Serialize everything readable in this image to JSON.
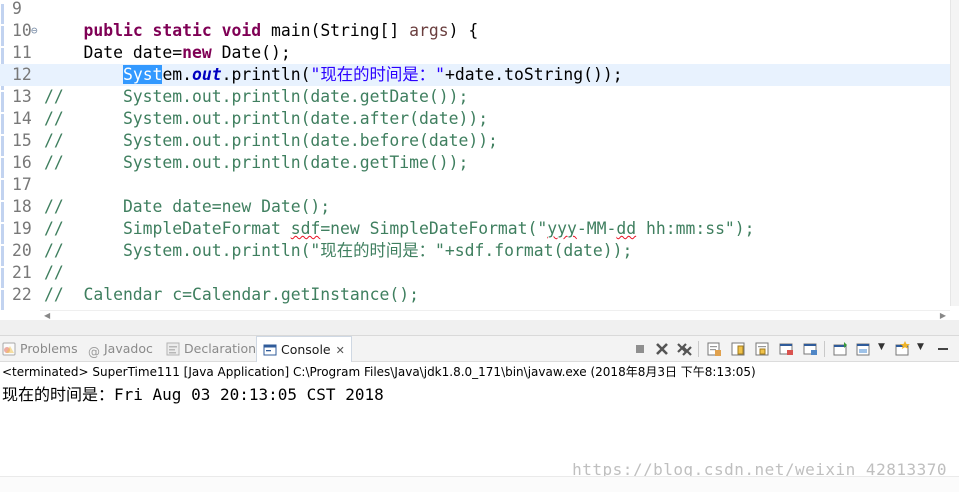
{
  "editor": {
    "lines": [
      {
        "no": "9"
      },
      {
        "no": "10",
        "fold": "⊖"
      },
      {
        "no": "11"
      },
      {
        "no": "12"
      },
      {
        "no": "13"
      },
      {
        "no": "14"
      },
      {
        "no": "15"
      },
      {
        "no": "16"
      },
      {
        "no": "17"
      },
      {
        "no": "18"
      },
      {
        "no": "19"
      },
      {
        "no": "20"
      },
      {
        "no": "21"
      },
      {
        "no": "22"
      }
    ],
    "code": {
      "l10_kw": "public static void",
      "l10_rest": " main(String[] ",
      "l10_args": "args",
      "l10_end": ") {",
      "l11_a": "Date date=",
      "l11_kw": "new",
      "l11_b": " Date();",
      "l12_sel": "Syst",
      "l12_a": "em.",
      "l12_fld": "out",
      "l12_b": ".println(",
      "l12_str": "\"现在的时间是：\"",
      "l12_c": "+date.toString());",
      "l13": "//      System.out.println(date.getDate());",
      "l14": "//      System.out.println(date.after(date));",
      "l15": "//      System.out.println(date.before(date));",
      "l16": "//      System.out.println(date.getTime());",
      "l18": "//      Date date=new Date();",
      "l19_a": "//      SimpleDateFormat ",
      "l19_sdf": "sdf",
      "l19_b": "=new SimpleDateFormat(\"",
      "l19_yyy": "yyy",
      "l19_c": "-MM-",
      "l19_dd": "dd",
      "l19_d": " hh:mm:ss\");",
      "l20": "//      System.out.println(\"现在的时间是：\"+sdf.format(date));",
      "l21": "//",
      "l22": "//  Calendar c=Calendar.getInstance();"
    }
  },
  "console": {
    "tabs": [
      {
        "label": "Problems"
      },
      {
        "label": "Javadoc"
      },
      {
        "label": "Declaration"
      },
      {
        "label": "Console",
        "close": "✕"
      }
    ],
    "description": "<terminated> SuperTime111 [Java Application] C:\\Program Files\\Java\\jdk1.8.0_171\\bin\\javaw.exe (2018年8月3日 下午8:13:05)",
    "output": "现在的时间是：Fri Aug 03 20:13:05 CST 2018",
    "watermark": "https://blog.csdn.net/weixin_42813370"
  },
  "colors": {
    "keyword": "#7f0055",
    "comment": "#3f7f5f",
    "string": "#2a00ff",
    "field": "#0000c0",
    "selection": "#3399ff",
    "current_line": "#e8f2fe"
  },
  "icons": {
    "problems": "problems-icon",
    "javadoc": "javadoc-icon",
    "declaration": "declaration-icon",
    "console": "console-icon"
  }
}
